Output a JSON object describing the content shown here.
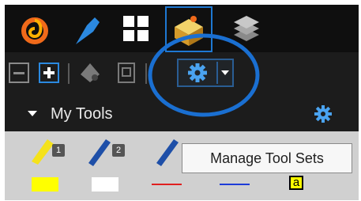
{
  "tabs": [
    {
      "name": "app-logo",
      "icon": "swirl-logo-icon"
    },
    {
      "name": "pin",
      "icon": "pin-icon"
    },
    {
      "name": "grid",
      "icon": "grid-icon"
    },
    {
      "name": "toolbox",
      "icon": "toolbox-icon",
      "active": true
    },
    {
      "name": "layers",
      "icon": "layers-icon"
    }
  ],
  "toolbar": {
    "buttons": [
      "collapse-icon",
      "expand-icon",
      "locate-icon",
      "document-icon",
      "gear-icon",
      "dropdown-icon"
    ]
  },
  "header": {
    "title": "My Tools"
  },
  "tools": {
    "items": [
      {
        "badge": "1",
        "swatch": "#ffff00"
      },
      {
        "badge": "2",
        "swatch": "#ffffff"
      },
      {
        "badge": "",
        "swatch": "#e02020"
      },
      {
        "badge": "",
        "swatch": "#1e3cd8"
      },
      {
        "badge": "",
        "text": "a"
      }
    ]
  },
  "tooltip": {
    "text": "Manage Tool Sets"
  },
  "colors": {
    "accent": "#1e78d2",
    "annotation": "#1a6fd1"
  }
}
